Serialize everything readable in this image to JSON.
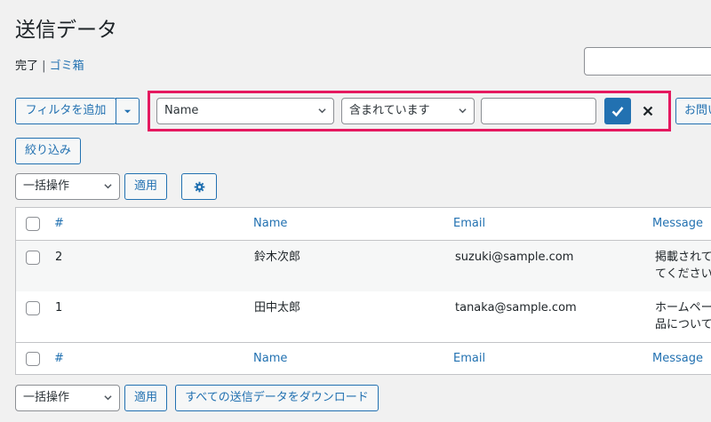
{
  "page": {
    "title": "送信データ"
  },
  "views": {
    "done": "完了",
    "separator": " | ",
    "trash": "ゴミ箱"
  },
  "filter": {
    "add_filter_label": "フィルタを追加",
    "field_select": "Name",
    "operator_select": "含まれています",
    "value": "",
    "apply_icon": "check-icon",
    "clear_icon": "close-icon",
    "partial_button": "お問い",
    "narrow_button": "絞り込み"
  },
  "bulk_top": {
    "select": "一括操作",
    "apply": "適用",
    "settings_icon": "gear-icon"
  },
  "table": {
    "columns": [
      "#",
      "Name",
      "Email",
      "Message"
    ],
    "rows": [
      {
        "id": "2",
        "name": "鈴木次郎",
        "email": "suzuki@sample.com",
        "message_line1": "掲載されて",
        "message_line2": "てください"
      },
      {
        "id": "1",
        "name": "田中太郎",
        "email": "tanaka@sample.com",
        "message_line1": "ホームペー",
        "message_line2": "品について"
      }
    ]
  },
  "bulk_bottom": {
    "select": "一括操作",
    "apply": "適用",
    "download": "すべての送信データをダウンロード"
  },
  "colors": {
    "accent": "#2271b1",
    "highlight": "#e5195f",
    "background": "#f1f1f1"
  }
}
